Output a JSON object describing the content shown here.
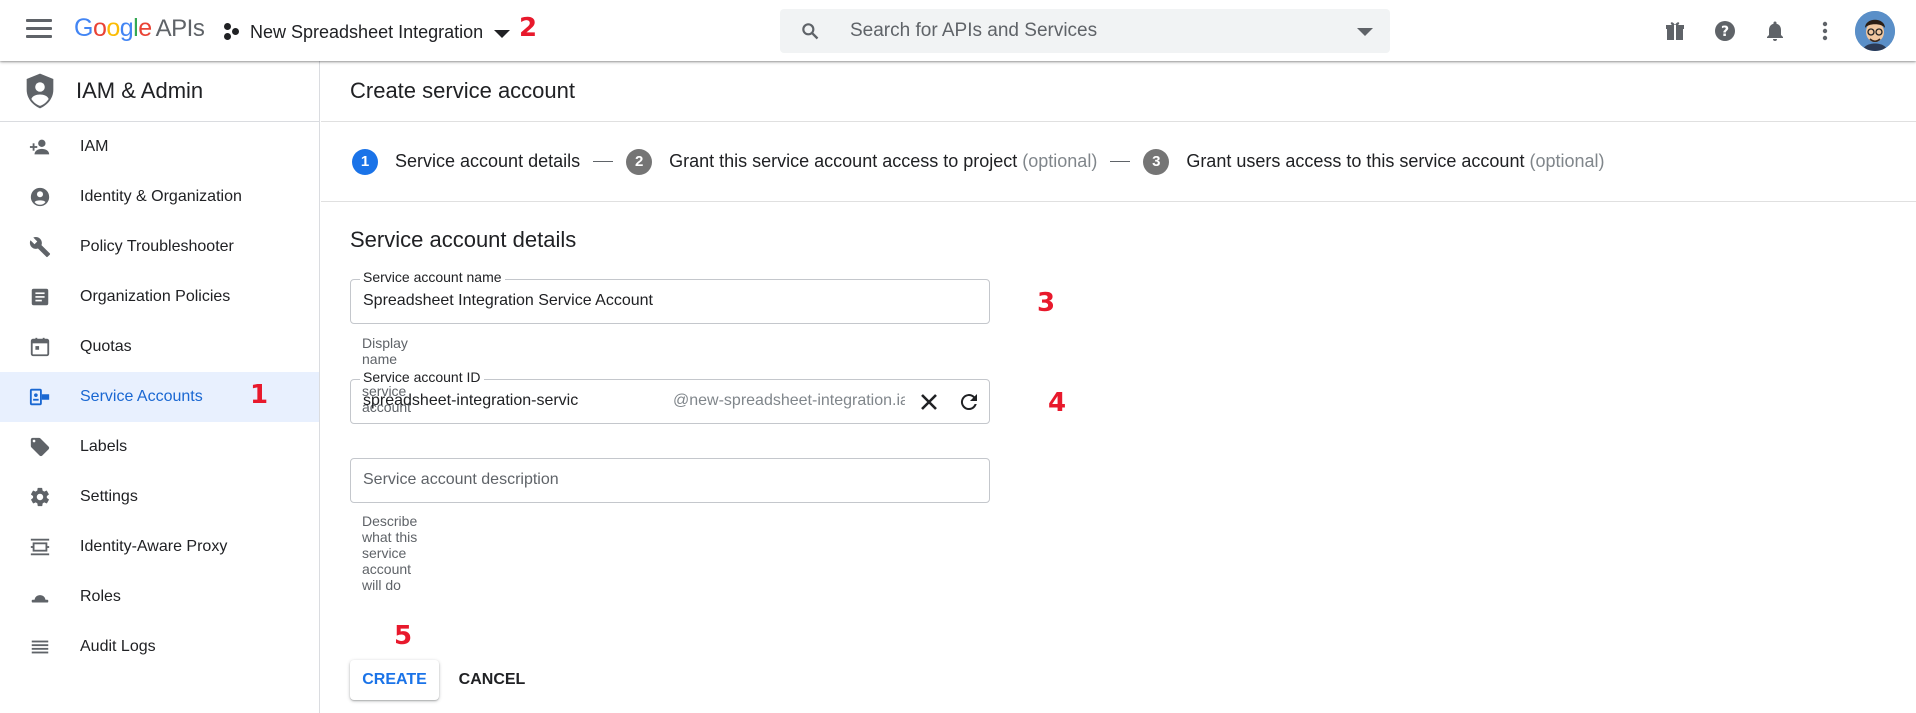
{
  "topbar": {
    "logo": {
      "google": "Google",
      "apis": "APIs"
    },
    "project": "New Spreadsheet Integration",
    "search_placeholder": "Search for APIs and Services",
    "icons": [
      "menu-icon",
      "search-icon",
      "gift-icon",
      "help-icon",
      "notifications-icon",
      "more-vert-icon",
      "avatar"
    ]
  },
  "annotations": {
    "n1": "1",
    "n2": "2",
    "n3": "3",
    "n4": "4",
    "n5": "5",
    "color": "#e8192c"
  },
  "sidebar": {
    "title": "IAM & Admin",
    "items": [
      {
        "label": "IAM",
        "icon": "person-add-icon"
      },
      {
        "label": "Identity & Organization",
        "icon": "account-circle-icon"
      },
      {
        "label": "Policy Troubleshooter",
        "icon": "wrench-icon"
      },
      {
        "label": "Organization Policies",
        "icon": "document-icon"
      },
      {
        "label": "Quotas",
        "icon": "calendar-icon"
      },
      {
        "label": "Service Accounts",
        "icon": "service-account-icon",
        "active": true
      },
      {
        "label": "Labels",
        "icon": "tag-icon"
      },
      {
        "label": "Settings",
        "icon": "gear-icon"
      },
      {
        "label": "Identity-Aware Proxy",
        "icon": "proxy-icon"
      },
      {
        "label": "Roles",
        "icon": "hat-icon"
      },
      {
        "label": "Audit Logs",
        "icon": "list-icon"
      }
    ]
  },
  "main": {
    "page_title": "Create service account",
    "steps": [
      {
        "num": "1",
        "label": "Service account details",
        "optional": ""
      },
      {
        "num": "2",
        "label": "Grant this service account access to project",
        "optional": "(optional)"
      },
      {
        "num": "3",
        "label": "Grant users access to this service account",
        "optional": "(optional)"
      }
    ],
    "section_title": "Service account details",
    "name_field": {
      "label": "Service account name",
      "value": "Spreadsheet Integration Service Account",
      "hint": "Display name for this service account"
    },
    "id_field": {
      "label": "Service account ID",
      "value": "spreadsheet-integration-servic",
      "suffix": "@new-spreadsheet-integration.iam.gserviceaccount.com"
    },
    "description_field": {
      "placeholder": "Service account description",
      "hint": "Describe what this service account will do"
    },
    "create_label": "CREATE",
    "cancel_label": "CANCEL"
  },
  "colors": {
    "accent": "#1a73e8",
    "active_bg": "#e8f0fe",
    "active_text": "#1967d2"
  }
}
